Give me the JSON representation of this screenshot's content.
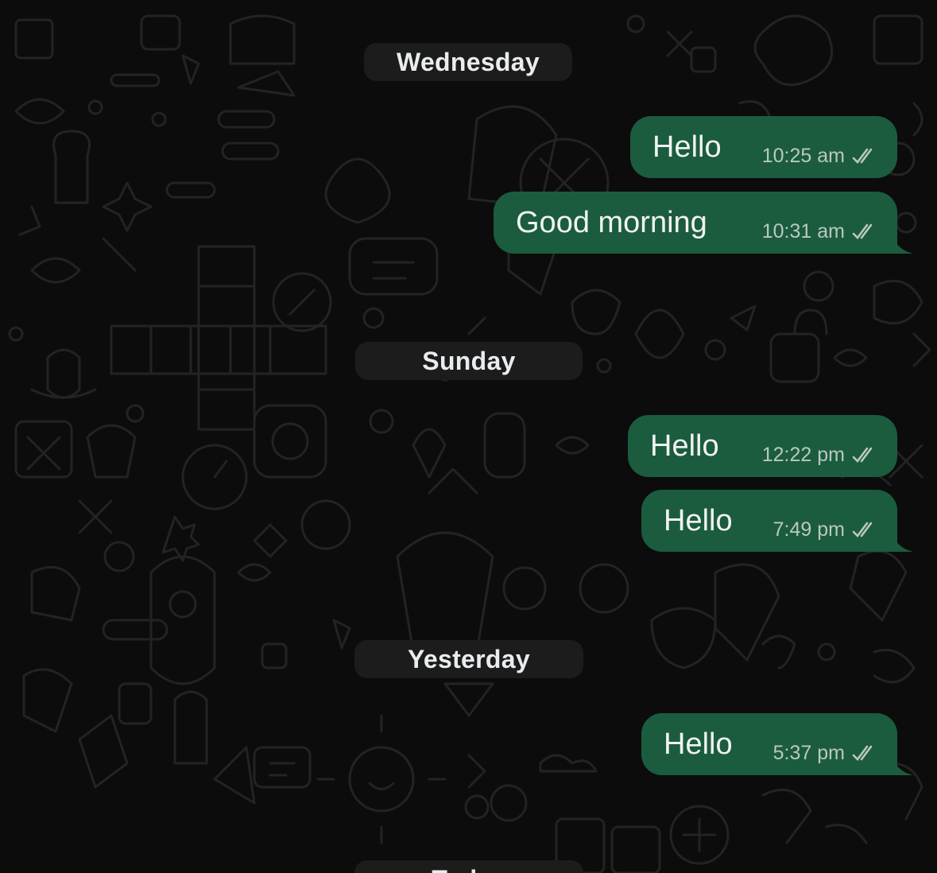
{
  "colors": {
    "background": "#0c0c0c",
    "outgoing_bubble": "#1b5c3e",
    "date_pill": "#1c1c1c",
    "text": "#f1f3f2",
    "meta_text": "#b9c8c0"
  },
  "icons": {
    "read_receipt": "double-check-icon"
  },
  "groups": [
    {
      "date": "Wednesday",
      "messages": [
        {
          "text": "Hello",
          "time": "10:25 am"
        },
        {
          "text": "Good morning",
          "time": "10:31 am"
        }
      ]
    },
    {
      "date": "Sunday",
      "messages": [
        {
          "text": "Hello",
          "time": "12:22 pm"
        },
        {
          "text": "Hello",
          "time": "7:49 pm"
        }
      ]
    },
    {
      "date": "Yesterday",
      "messages": [
        {
          "text": "Hello",
          "time": "5:37 pm"
        }
      ]
    },
    {
      "date": "Today",
      "messages": []
    }
  ]
}
